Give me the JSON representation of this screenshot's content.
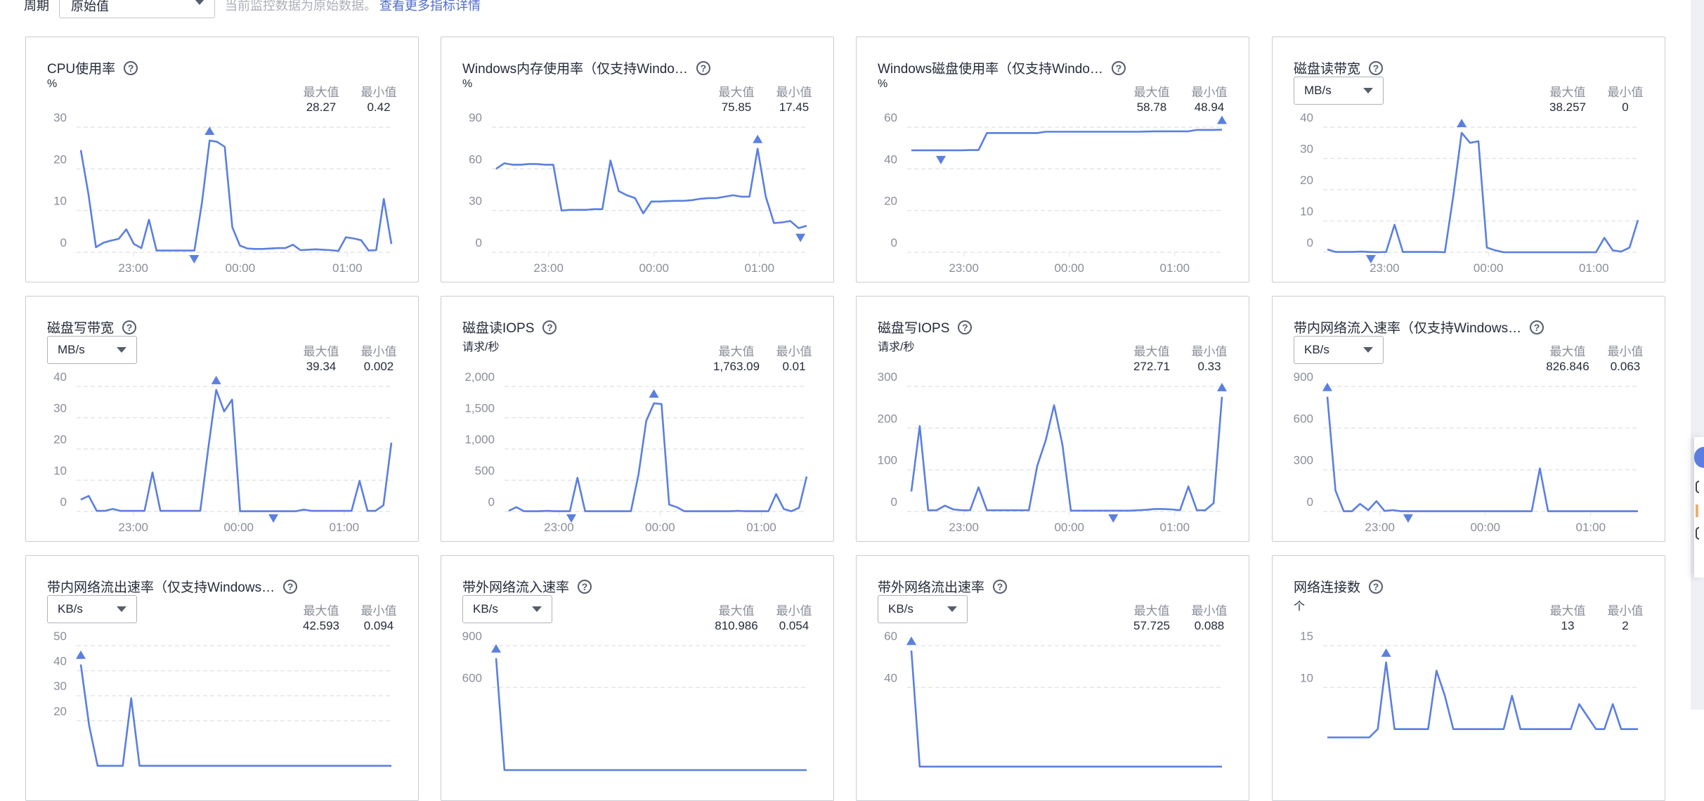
{
  "topbar": {
    "period_label": "周期",
    "period_value": "原始值",
    "note": "当前监控数据为原始数据。",
    "link": "查看更多指标详情"
  },
  "labels": {
    "max": "最大值",
    "min": "最小值"
  },
  "colors": {
    "line": "#5b7fe0",
    "grid": "#e3e5ea",
    "link": "#526ecc"
  },
  "chart_data": [
    {
      "type": "line",
      "title": "CPU使用率",
      "unit": "%",
      "unit_select": false,
      "max": "28.27",
      "min": "0.42",
      "yticks": [
        0,
        10,
        20,
        30
      ],
      "ytick_labels": [
        "0",
        "10",
        "20",
        "30"
      ],
      "ylim": [
        0,
        30
      ],
      "xticks": [
        "23:00",
        "00:00",
        "01:00"
      ],
      "xtick_pos": [
        0.18,
        0.52,
        0.86
      ],
      "values": [
        24.5,
        14,
        1.2,
        2.3,
        2.8,
        3.2,
        5.5,
        2,
        1,
        7.8,
        0.4,
        0.4,
        0.4,
        0.4,
        0.4,
        0.4,
        12,
        26.8,
        26.5,
        25.3,
        6,
        1.6,
        0.9,
        0.8,
        0.8,
        0.9,
        1,
        1,
        1.8,
        0.5,
        0.6,
        0.7,
        0.6,
        0.5,
        0.3,
        3.6,
        3.3,
        2.9,
        0.4,
        0.5,
        12.8,
        2
      ],
      "max_marker": 0.435,
      "min_marker": 0.365
    },
    {
      "type": "line",
      "title": "Windows内存使用率（仅支持Windo…",
      "unit": "%",
      "unit_select": false,
      "max": "75.85",
      "min": "17.45",
      "yticks": [
        0,
        30,
        60,
        90
      ],
      "ytick_labels": [
        "0",
        "30",
        "60",
        "90"
      ],
      "ylim": [
        0,
        90
      ],
      "xticks": [
        "23:00",
        "00:00",
        "01:00"
      ],
      "xtick_pos": [
        0.18,
        0.515,
        0.85
      ],
      "values": [
        60,
        64,
        63,
        63,
        63.5,
        63.5,
        63,
        63,
        30,
        30.5,
        30.5,
        30.5,
        31,
        31,
        66,
        44,
        41,
        39,
        28,
        36.5,
        36.5,
        36.8,
        37,
        37,
        37.5,
        38.5,
        39,
        39,
        40,
        41,
        40,
        40,
        74.5,
        40,
        21,
        21.5,
        22.5,
        17.4,
        19
      ],
      "max_marker": 0.86,
      "min_marker": 0.98
    },
    {
      "type": "line",
      "title": "Windows磁盘使用率（仅支持Windo…",
      "unit": "%",
      "unit_select": false,
      "max": "58.78",
      "min": "48.94",
      "yticks": [
        0,
        20,
        40,
        60
      ],
      "ytick_labels": [
        "0",
        "20",
        "40",
        "60"
      ],
      "ylim": [
        0,
        60
      ],
      "xticks": [
        "23:00",
        "00:00",
        "01:00"
      ],
      "xtick_pos": [
        0.18,
        0.515,
        0.85
      ],
      "values": [
        48.9,
        48.9,
        48.9,
        48.9,
        48.9,
        48.9,
        48.9,
        49,
        49,
        57.2,
        57.2,
        57.2,
        57.2,
        57.2,
        57.2,
        57.2,
        57.8,
        57.8,
        57.8,
        57.8,
        57.8,
        57.8,
        57.8,
        57.8,
        57.8,
        57.8,
        57.8,
        57.8,
        57.9,
        58,
        58,
        58,
        58,
        58,
        58.7,
        58.7,
        58.7,
        58.8
      ],
      "max_marker": 1.0,
      "min_marker": 0.095
    },
    {
      "type": "line",
      "title": "磁盘读带宽",
      "unit": "MB/s",
      "unit_select": true,
      "max": "38.257",
      "min": "0",
      "yticks": [
        0,
        10,
        20,
        30,
        40
      ],
      "ytick_labels": [
        "0",
        "10",
        "20",
        "30",
        "40"
      ],
      "ylim": [
        0,
        40
      ],
      "xticks": [
        "23:00",
        "00:00",
        "01:00"
      ],
      "xtick_pos": [
        0.195,
        0.525,
        0.86
      ],
      "values": [
        0.9,
        0.1,
        0.1,
        0.1,
        0.2,
        0.1,
        0,
        0.1,
        8.8,
        0.1,
        0.1,
        0.1,
        0.1,
        0.1,
        0,
        18,
        38.2,
        35,
        35.5,
        1.5,
        0.6,
        0,
        0,
        0,
        0,
        0,
        0,
        0,
        0,
        0,
        0,
        0,
        0,
        4.6,
        0.6,
        0.2,
        1.5,
        10.3
      ],
      "max_marker": 0.42,
      "min_marker": 0.14
    },
    {
      "type": "line",
      "title": "磁盘写带宽",
      "unit": "MB/s",
      "unit_select": true,
      "max": "39.34",
      "min": "0.002",
      "yticks": [
        0,
        10,
        20,
        30,
        40
      ],
      "ytick_labels": [
        "0",
        "10",
        "20",
        "30",
        "40"
      ],
      "ylim": [
        0,
        40
      ],
      "xticks": [
        "23:00",
        "00:00",
        "01:00"
      ],
      "xtick_pos": [
        0.18,
        0.515,
        0.85
      ],
      "values": [
        3.8,
        5,
        0.2,
        0.2,
        0.8,
        0.2,
        0.2,
        0.2,
        0.2,
        12.5,
        0.2,
        0.2,
        0.2,
        0.2,
        0.2,
        0.2,
        20,
        38.9,
        32,
        35.8,
        0.1,
        0.1,
        0.1,
        0.1,
        0.1,
        0.1,
        0.1,
        0.1,
        0.6,
        0.2,
        0.2,
        0.2,
        0.2,
        0.2,
        0.2,
        9.8,
        0.2,
        0.2,
        2,
        22
      ],
      "max_marker": 0.42,
      "min_marker": 0.62
    },
    {
      "type": "line",
      "title": "磁盘读IOPS",
      "unit": "请求/秒",
      "unit_select": false,
      "max": "1,763.09",
      "min": "0.01",
      "yticks": [
        0,
        500,
        1000,
        1500,
        2000
      ],
      "ytick_labels": [
        "0",
        "500",
        "1,000",
        "1,500",
        "2,000"
      ],
      "ylim": [
        0,
        2000
      ],
      "xticks": [
        "23:00",
        "00:00",
        "01:00"
      ],
      "xtick_pos": [
        0.18,
        0.515,
        0.85
      ],
      "values": [
        10,
        70,
        5,
        5,
        5,
        10,
        5,
        5,
        5,
        540,
        5,
        5,
        5,
        5,
        5,
        5,
        5,
        600,
        1450,
        1730,
        1720,
        110,
        70,
        5,
        5,
        5,
        5,
        5,
        5,
        5,
        10,
        5,
        5,
        5,
        5,
        280,
        40,
        5,
        60,
        560
      ],
      "max_marker": 0.44,
      "min_marker": 0.21
    },
    {
      "type": "line",
      "title": "磁盘写IOPS",
      "unit": "请求/秒",
      "unit_select": false,
      "max": "272.71",
      "min": "0.33",
      "yticks": [
        0,
        100,
        200,
        300
      ],
      "ytick_labels": [
        "0",
        "100",
        "200",
        "300"
      ],
      "ylim": [
        0,
        300
      ],
      "xticks": [
        "23:00",
        "00:00",
        "01:00"
      ],
      "xtick_pos": [
        0.18,
        0.515,
        0.85
      ],
      "values": [
        48,
        205,
        3,
        3,
        14,
        5,
        3,
        3,
        58,
        3,
        3,
        3,
        3,
        3,
        3,
        110,
        170,
        255,
        160,
        2,
        2,
        2,
        2,
        2,
        2,
        2,
        2,
        3,
        4,
        6,
        6,
        5,
        3,
        60,
        3,
        3,
        20,
        275
      ],
      "max_marker": 1.0,
      "min_marker": 0.65
    },
    {
      "type": "line",
      "title": "带内网络流入速率（仅支持Windows…",
      "unit": "KB/s",
      "unit_select": true,
      "max": "826.846",
      "min": "0.063",
      "yticks": [
        0,
        300,
        600,
        900
      ],
      "ytick_labels": [
        "0",
        "300",
        "600",
        "900"
      ],
      "ylim": [
        0,
        900
      ],
      "xticks": [
        "23:00",
        "00:00",
        "01:00"
      ],
      "xtick_pos": [
        0.18,
        0.515,
        0.85
      ],
      "values": [
        826,
        150,
        2,
        2,
        55,
        10,
        75,
        4,
        10,
        2,
        2,
        2,
        2,
        2,
        2,
        2,
        2,
        2,
        2,
        2,
        2,
        2,
        2,
        2,
        2,
        2,
        310,
        2,
        2,
        2,
        2,
        2,
        2,
        2,
        2,
        2,
        2,
        2,
        2
      ],
      "max_marker": 0.0,
      "min_marker": 0.26
    },
    {
      "type": "line",
      "title": "带内网络流出速率（仅支持Windows…",
      "unit": "KB/s",
      "unit_select": true,
      "max": "42.593",
      "min": "0.094",
      "yticks": [
        20,
        30,
        40,
        50
      ],
      "ytick_labels": [
        "20",
        "30",
        "40",
        "50"
      ],
      "ylim": [
        0,
        50
      ],
      "xticks": [],
      "xtick_pos": [],
      "values": [
        42.5,
        18,
        2,
        2,
        2,
        2,
        29,
        2,
        2,
        2,
        2,
        2,
        2,
        2,
        2,
        2,
        2,
        2,
        2,
        2,
        2,
        2,
        2,
        2,
        2,
        2,
        2,
        2,
        2,
        2,
        2,
        2,
        2,
        2,
        2,
        2,
        2,
        2
      ],
      "max_marker": 0.0,
      "min_marker": null
    },
    {
      "type": "line",
      "title": "带外网络流入速率",
      "unit": "KB/s",
      "unit_select": true,
      "max": "810.986",
      "min": "0.054",
      "yticks": [
        600,
        900
      ],
      "ytick_labels": [
        "600",
        "900"
      ],
      "ylim": [
        0,
        900
      ],
      "xticks": [],
      "xtick_pos": [],
      "values": [
        810,
        5,
        5,
        5,
        5,
        5,
        5,
        5,
        5,
        5,
        5,
        5,
        5,
        5,
        5,
        5,
        5,
        5,
        5,
        5,
        5,
        5,
        5,
        5,
        5,
        5,
        5,
        5,
        5,
        5,
        5,
        5,
        5,
        5,
        5,
        5,
        5,
        5
      ],
      "max_marker": 0.0,
      "min_marker": null
    },
    {
      "type": "line",
      "title": "带外网络流出速率",
      "unit": "KB/s",
      "unit_select": true,
      "max": "57.725",
      "min": "0.088",
      "yticks": [
        40,
        60
      ],
      "ytick_labels": [
        "40",
        "60"
      ],
      "ylim": [
        0,
        60
      ],
      "xticks": [],
      "xtick_pos": [],
      "values": [
        57.7,
        2,
        2,
        2,
        2,
        2,
        2,
        2,
        2,
        2,
        2,
        2,
        2,
        2,
        2,
        2,
        2,
        2,
        2,
        2,
        2,
        2,
        2,
        2,
        2,
        2,
        2,
        2,
        2,
        2,
        2,
        2,
        2,
        2,
        2,
        2,
        2,
        2
      ],
      "max_marker": 0.0,
      "min_marker": null
    },
    {
      "type": "line",
      "title": "网络连接数",
      "unit": "个",
      "unit_select": false,
      "max": "13",
      "min": "2",
      "yticks": [
        10,
        15
      ],
      "ytick_labels": [
        "10",
        "15"
      ],
      "ylim": [
        0,
        15
      ],
      "xticks": [],
      "xtick_pos": [],
      "values": [
        4,
        4,
        4,
        4,
        4,
        4,
        5,
        13,
        5,
        5,
        5,
        5,
        5,
        12,
        9,
        5,
        5,
        5,
        5,
        5,
        5,
        5,
        9,
        5,
        5,
        5,
        5,
        5,
        5,
        5,
        8,
        6.5,
        5,
        5,
        8,
        5,
        5,
        5
      ],
      "max_marker": 0.22,
      "min_marker": null
    }
  ]
}
